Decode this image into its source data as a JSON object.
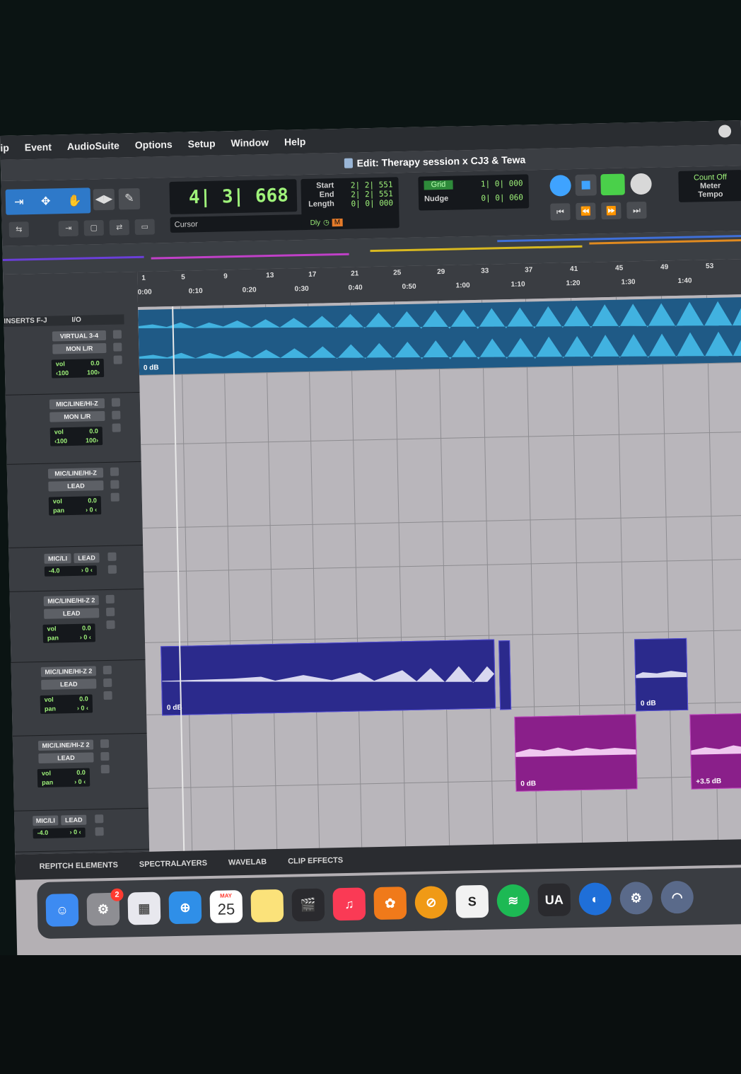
{
  "menu": [
    "ip",
    "Event",
    "AudioSuite",
    "Options",
    "Setup",
    "Window",
    "Help"
  ],
  "window_title": "Edit: Therapy session x CJ3 & Tewa",
  "counter": {
    "main": "4| 3| 668",
    "cursor_label": "Cursor"
  },
  "selection": {
    "labels": [
      "Start",
      "End",
      "Length"
    ],
    "values": [
      "2| 2| 551",
      "2| 2| 551",
      "0| 0| 000"
    ],
    "dly": "Dly",
    "m": "M"
  },
  "grid": {
    "grid_tag": "Grid",
    "grid_value": "1| 0| 000",
    "nudge_label": "Nudge",
    "nudge_value": "0| 0| 060"
  },
  "count_box": {
    "line1": "Count Off",
    "line2": "Meter",
    "line3": "Tempo"
  },
  "ruler": {
    "bars": [
      "1",
      "5",
      "9",
      "13",
      "17",
      "21",
      "25",
      "29",
      "33",
      "37",
      "41",
      "45",
      "49",
      "53"
    ],
    "times": [
      "0:00",
      "0:10",
      "0:20",
      "0:30",
      "0:40",
      "0:50",
      "1:00",
      "1:10",
      "1:20",
      "1:30",
      "1:40"
    ]
  },
  "track_header": {
    "inserts": "INSERTS F-J",
    "io": "I/O"
  },
  "tracks": [
    {
      "in": "VIRTUAL 3-4",
      "out": "MON L/R",
      "vol": "vol",
      "vol_val": "0.0",
      "pan_l": "‹100",
      "pan_r": "100›"
    },
    {
      "in": "MIC/LINE/HI-Z",
      "out": "MON L/R",
      "vol": "vol",
      "vol_val": "0.0",
      "pan_l": "‹100",
      "pan_r": "100›"
    },
    {
      "in": "MIC/LINE/HI-Z",
      "out": "LEAD",
      "vol": "vol",
      "vol_val": "0.0",
      "pan_l": "pan",
      "pan_r": "› 0 ‹"
    },
    {
      "in": "MIC/LI",
      "out": "LEAD",
      "vol_val": "-4.0",
      "pan_r": "› 0 ‹"
    },
    {
      "in": "MIC/LINE/HI-Z 2",
      "out": "LEAD",
      "vol": "vol",
      "vol_val": "0.0",
      "pan_l": "pan",
      "pan_r": "› 0 ‹"
    },
    {
      "in": "MIC/LINE/HI-Z 2",
      "out": "LEAD",
      "vol": "vol",
      "vol_val": "0.0",
      "pan_l": "pan",
      "pan_r": "› 0 ‹"
    },
    {
      "in": "MIC/LINE/HI-Z 2",
      "out": "LEAD",
      "vol": "vol",
      "vol_val": "0.0",
      "pan_l": "pan",
      "pan_r": "› 0 ‹"
    },
    {
      "in": "MIC/LI",
      "out": "LEAD",
      "vol_val": "-4.0",
      "pan_r": "› 0 ‹"
    }
  ],
  "clips": [
    {
      "gain": "0 dB"
    },
    {
      "gain": "0 dB"
    },
    {
      "gain": "0 dB"
    },
    {
      "gain": "0 dB"
    },
    {
      "gain": "+3.5 dB"
    }
  ],
  "bottom_tabs": [
    "REPITCH ELEMENTS",
    "SPECTRALAYERS",
    "WAVELAB",
    "CLIP EFFECTS"
  ],
  "dock": {
    "badge": "2",
    "calendar_month": "MAY",
    "calendar_day": "25",
    "ua_label": "UA"
  },
  "colors": {
    "waveform_cyan": "#3fb8ea",
    "clip_blue": "#2b2a8c",
    "clip_magenta": "#8a1f8a",
    "counter_green": "#9ff37a",
    "tool_blue": "#2e79c9"
  }
}
